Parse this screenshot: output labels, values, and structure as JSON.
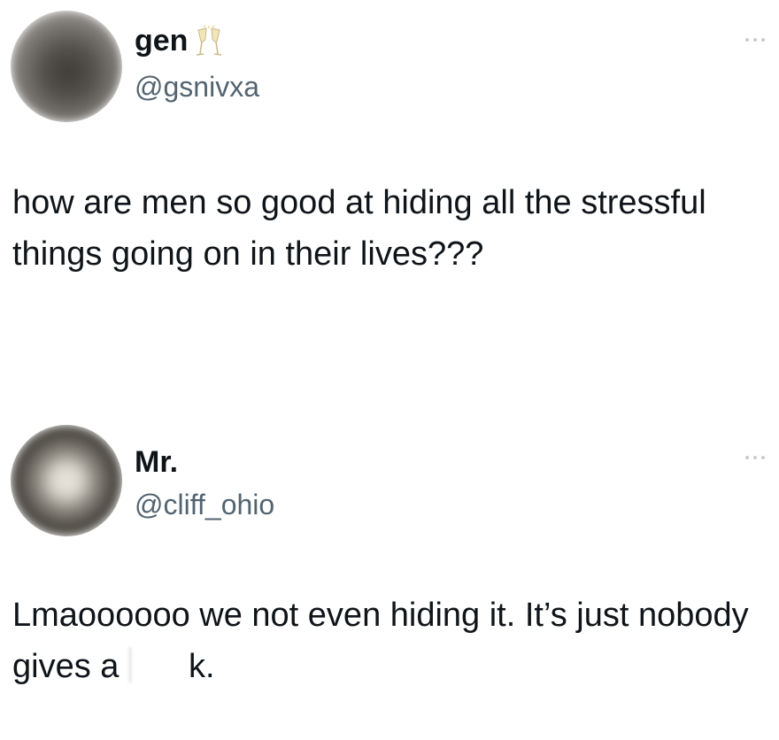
{
  "tweets": [
    {
      "display_name": "gen",
      "name_emoji": "champagne-glasses-icon",
      "handle": "@gsnivxa",
      "text": "how are men so good at hiding all the stressful things going on in their lives???"
    },
    {
      "display_name": "Mr.",
      "handle": "@cliff_ohio",
      "text_before": "Lmaoooooo we not even hiding it. It’s just nobody gives a ",
      "text_after": "k."
    }
  ]
}
